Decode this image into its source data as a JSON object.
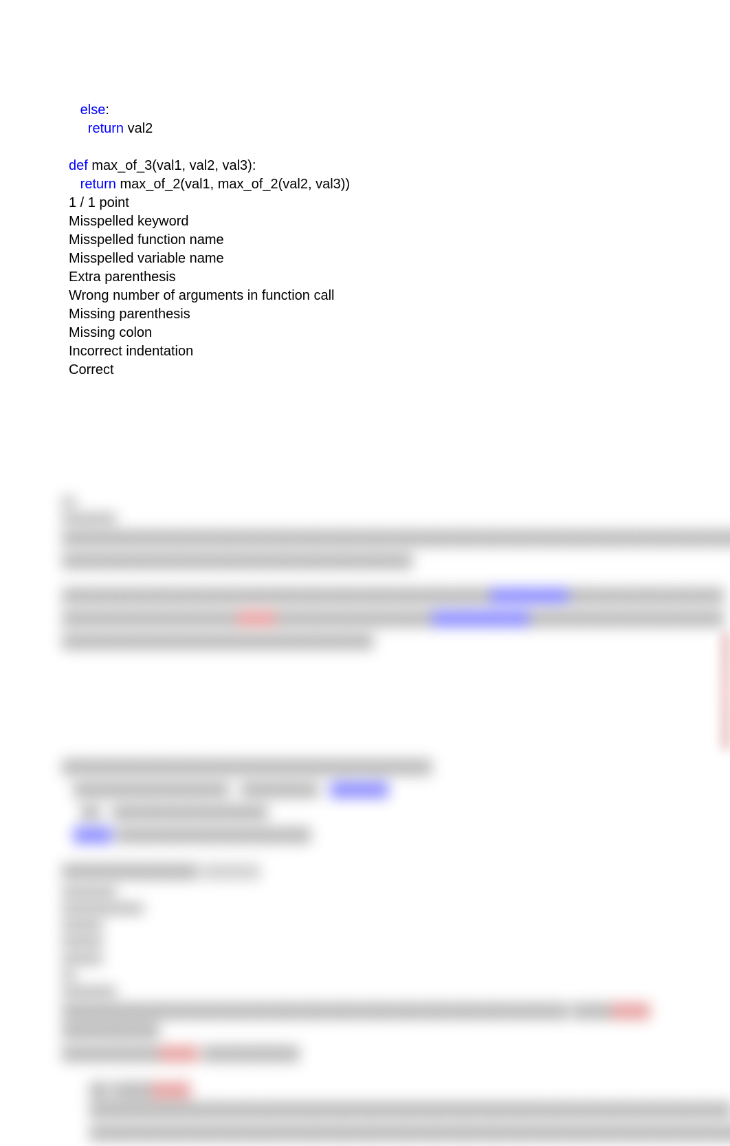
{
  "code": {
    "l1": "   else:",
    "l1_p1": "   ",
    "l1_p2": "else",
    "l1_p3": ":",
    "l2_p1": "     ",
    "l2_p2": "return",
    "l2_p3": " val2",
    "blank1": " ",
    "l3_p1": "def",
    "l3_p2": " max_of_3(val1, val2, val3):",
    "l4_p1": "   ",
    "l4_p2": "return",
    "l4_p3": " max_of_2(val1, max_of_2(val2, val3))"
  },
  "score": "1 / 1 point",
  "options": [
    "Misspelled keyword",
    "Misspelled function name",
    "Misspelled variable name",
    "Extra parenthesis",
    "Wrong number of arguments in function call",
    "Missing parenthesis",
    "Missing colon",
    "Incorrect indentation",
    "Correct"
  ]
}
